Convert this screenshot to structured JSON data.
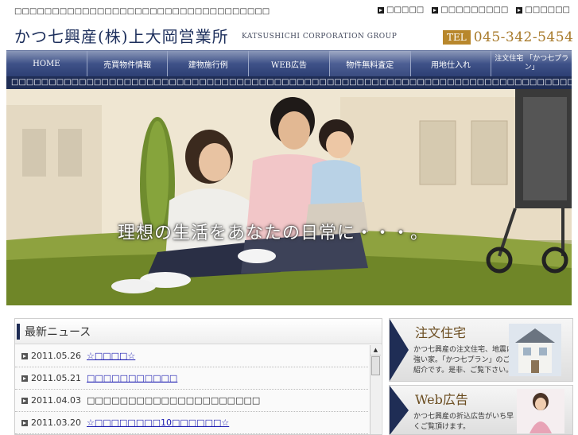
{
  "header": {
    "tagline": "□□□□□□□□□□□□□□□□□□□□□□□□□□□□□□□□□□",
    "links": [
      {
        "label": "□□□□□"
      },
      {
        "label": "□□□□□□□□□"
      },
      {
        "label": "□□□□□□"
      }
    ],
    "logo_jp": "かつ七興産(株)上大岡営業所",
    "logo_en": "KATSUSHICHI CORPORATION GROUP",
    "tel_label": "TEL",
    "tel_number": "045-342-5454"
  },
  "nav": {
    "items": [
      {
        "label": "HOME"
      },
      {
        "label": "売買物件情報"
      },
      {
        "label": "建物施行例"
      },
      {
        "label": "WEB広告"
      },
      {
        "label": "物件無料査定"
      },
      {
        "label": "用地仕入れ"
      },
      {
        "label": "注文住宅 「かつ七プラン」"
      }
    ]
  },
  "ticker": {
    "text": "□□□□□□□□□□□□□□□□□□□□□□□□□□□□□□□□□□□□□□□□□□□□□□□□□□□□□□□□□□□□□□□□□□□□□□□□□□□□□□□□□□□"
  },
  "hero": {
    "caption": "理想の生活をあなたの日常に・・・。"
  },
  "news": {
    "title": "最新ニュース",
    "items": [
      {
        "date": "2011.05.26",
        "text": "☆□□□□☆",
        "link": true
      },
      {
        "date": "2011.05.21",
        "text": "□□□□□□□□□□□",
        "link": true
      },
      {
        "date": "2011.04.03",
        "text": "□□□□□□□□□□□□□□□□□□□□□",
        "link": false
      },
      {
        "date": "2011.03.20",
        "text": "☆□□□□□□□□10□□□□□□☆",
        "link": true
      }
    ]
  },
  "side": {
    "custom_home": {
      "title": "注文住宅",
      "text": "かつ七興産の注文住宅、地震に強い家。「かつ七プラン」のご紹介です。是非、ご覧下さい。"
    },
    "web_ad": {
      "title": "Web広告",
      "text": "かつ七興産の折込広告がいち早くご覧頂けます。"
    }
  }
}
